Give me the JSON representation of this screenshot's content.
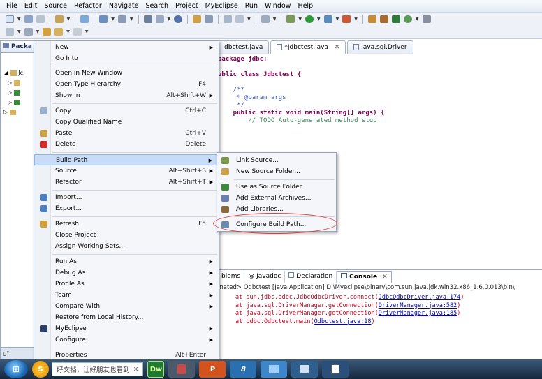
{
  "menubar": [
    "File",
    "Edit",
    "Source",
    "Refactor",
    "Navigate",
    "Search",
    "Project",
    "MyEclipse",
    "Run",
    "Window",
    "Help"
  ],
  "package_explorer": {
    "tab_label": "Packa",
    "tree": [
      "Jc",
      "",
      "",
      "",
      ""
    ]
  },
  "editor": {
    "tabs": [
      "dbctest.java",
      "*Jdbctest.java",
      "java.sql.Driver"
    ],
    "code_lines": [
      {
        "kind": "kw",
        "text": "package jdbc;"
      },
      {
        "kind": "plain",
        "text": ""
      },
      {
        "kind": "kw",
        "text": "ublic class Jdbctest {"
      },
      {
        "kind": "plain",
        "text": ""
      },
      {
        "kind": "jd",
        "text": "    /**"
      },
      {
        "kind": "jd",
        "text": "     * @param args"
      },
      {
        "kind": "jd",
        "text": "     */"
      },
      {
        "kind": "kw",
        "text": "    public static void main(String[] args) {"
      },
      {
        "kind": "cm",
        "text": "        // TODO Auto-generated method stub"
      }
    ]
  },
  "console": {
    "tabs": [
      "blems",
      "Javadoc",
      "Declaration",
      "Console"
    ],
    "header": "inated> Odbctest [Java Application] D:\\Myeclipse\\binary\\com.sun.java.jdk.win32.x86_1.6.0.013\\bin\\",
    "lines": [
      {
        "text": "at sun.jdbc.odbc.JdbcOdbcDriver.connect(",
        "link": "JdbcOdbcDriver.java:174",
        "end": ")"
      },
      {
        "text": "at java.sql.DriverManager.getConnection(",
        "link": "DriverManager.java:582",
        "end": ")"
      },
      {
        "text": "at java.sql.DriverManager.getConnection(",
        "link": "DriverManager.java:185",
        "end": ")"
      },
      {
        "text": "at odbc.Odbctest.main(",
        "link": "Odbctest.java:18",
        "end": ")"
      }
    ]
  },
  "context_menu": {
    "items": [
      {
        "label": "New",
        "accel": "",
        "arrow": true,
        "icon": ""
      },
      {
        "label": "Go Into",
        "accel": "",
        "arrow": false,
        "icon": ""
      },
      {
        "label": "Open in New Window",
        "accel": "",
        "arrow": false,
        "icon": ""
      },
      {
        "label": "Open Type Hierarchy",
        "accel": "F4",
        "arrow": false,
        "icon": ""
      },
      {
        "label": "Show In",
        "accel": "Alt+Shift+W",
        "arrow": true,
        "icon": ""
      },
      {
        "label": "Copy",
        "accel": "Ctrl+C",
        "arrow": false,
        "icon": "copy-icon"
      },
      {
        "label": "Copy Qualified Name",
        "accel": "",
        "arrow": false,
        "icon": ""
      },
      {
        "label": "Paste",
        "accel": "Ctrl+V",
        "arrow": false,
        "icon": "paste-icon"
      },
      {
        "label": "Delete",
        "accel": "Delete",
        "arrow": false,
        "icon": "delete-icon"
      },
      {
        "label": "Build Path",
        "accel": "",
        "arrow": true,
        "icon": ""
      },
      {
        "label": "Source",
        "accel": "Alt+Shift+S",
        "arrow": true,
        "icon": ""
      },
      {
        "label": "Refactor",
        "accel": "Alt+Shift+T",
        "arrow": true,
        "icon": ""
      },
      {
        "label": "Import...",
        "accel": "",
        "arrow": false,
        "icon": "import-icon"
      },
      {
        "label": "Export...",
        "accel": "",
        "arrow": false,
        "icon": "export-icon"
      },
      {
        "label": "Refresh",
        "accel": "F5",
        "arrow": false,
        "icon": "refresh-icon"
      },
      {
        "label": "Close Project",
        "accel": "",
        "arrow": false,
        "icon": ""
      },
      {
        "label": "Assign Working Sets...",
        "accel": "",
        "arrow": false,
        "icon": ""
      },
      {
        "label": "Run As",
        "accel": "",
        "arrow": true,
        "icon": ""
      },
      {
        "label": "Debug As",
        "accel": "",
        "arrow": true,
        "icon": ""
      },
      {
        "label": "Profile As",
        "accel": "",
        "arrow": true,
        "icon": ""
      },
      {
        "label": "Team",
        "accel": "",
        "arrow": true,
        "icon": ""
      },
      {
        "label": "Compare With",
        "accel": "",
        "arrow": true,
        "icon": ""
      },
      {
        "label": "Restore from Local History...",
        "accel": "",
        "arrow": false,
        "icon": ""
      },
      {
        "label": "MyEclipse",
        "accel": "",
        "arrow": true,
        "icon": "myeclipse-icon"
      },
      {
        "label": "Configure",
        "accel": "",
        "arrow": true,
        "icon": ""
      },
      {
        "label": "Properties",
        "accel": "Alt+Enter",
        "arrow": false,
        "icon": ""
      }
    ]
  },
  "build_path_submenu": {
    "items": [
      {
        "label": "Link Source...",
        "icon": "link-source-icon"
      },
      {
        "label": "New Source Folder...",
        "icon": "new-source-folder-icon"
      },
      {
        "label": "Use as Source Folder",
        "icon": "source-folder-icon"
      },
      {
        "label": "Add External Archives...",
        "icon": "jar-icon"
      },
      {
        "label": "Add Libraries...",
        "icon": "library-icon"
      },
      {
        "label": "Configure Build Path...",
        "icon": "configure-icon"
      }
    ]
  },
  "taskbar": {
    "notice": "好文档，让好朋友也看到",
    "dw_label": "Dw"
  }
}
